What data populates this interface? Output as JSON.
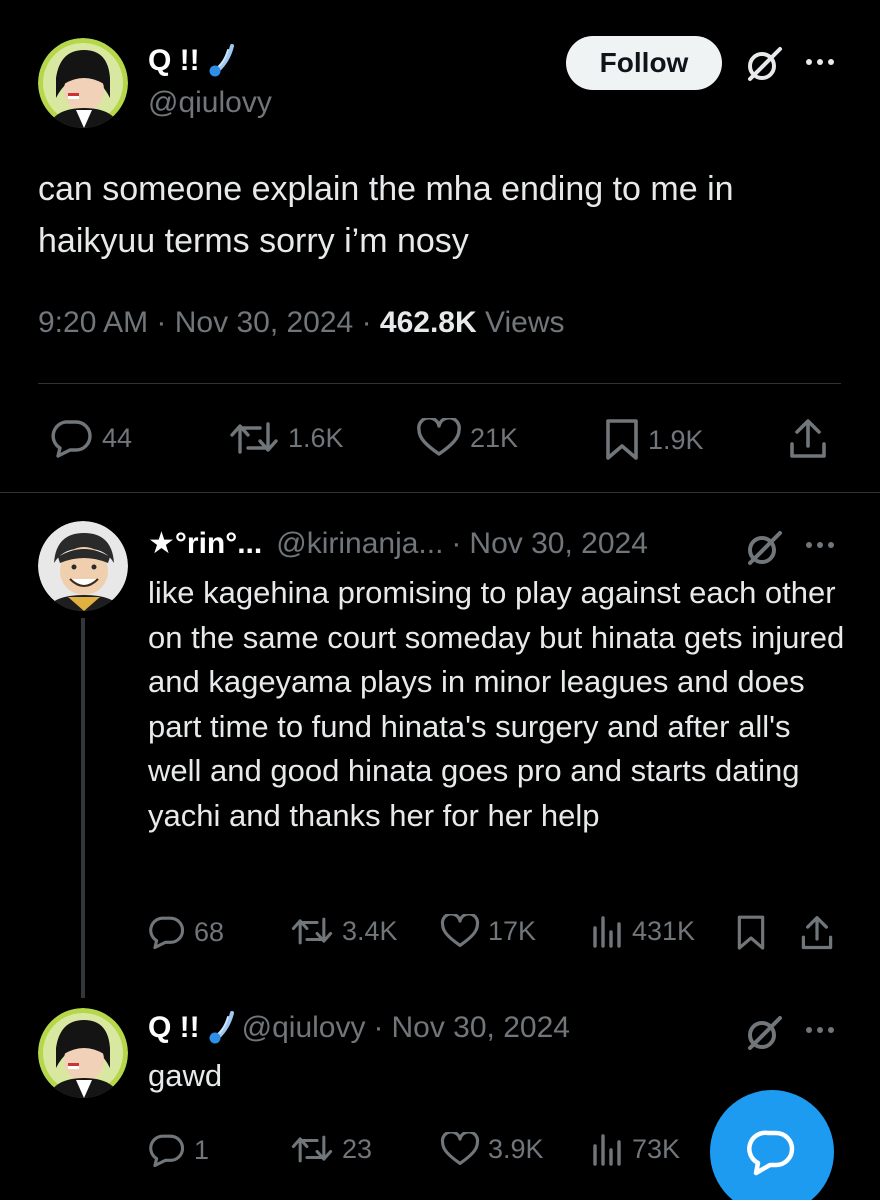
{
  "main_tweet": {
    "display_name": "Q !!",
    "handle": "@qiulovy",
    "follow_label": "Follow",
    "text": "can someone explain the mha ending to me in haikyuu terms sorry i’m nosy",
    "time": "9:20 AM",
    "date": "Nov 30, 2024",
    "views_count": "462.8K",
    "views_label": "Views",
    "actions": {
      "replies": "44",
      "reposts": "1.6K",
      "likes": "21K",
      "bookmarks": "1.9K"
    }
  },
  "reply_1": {
    "display_name": "★°rin°...",
    "handle": "@kirinanja...",
    "date": "Nov 30, 2024",
    "text": "like kagehina promising to play against each other on the same court someday but hinata gets injured and kageyama plays in minor leagues and does part time to fund hinata's surgery and after all's well and good hinata goes pro and starts dating yachi and thanks her for her help",
    "actions": {
      "replies": "68",
      "reposts": "3.4K",
      "likes": "17K",
      "views": "431K"
    }
  },
  "reply_2": {
    "display_name": "Q !!",
    "handle": "@qiulovy",
    "date": "Nov 30, 2024",
    "text": "gawd",
    "actions": {
      "replies": "1",
      "reposts": "23",
      "likes": "3.9K",
      "views": "73K"
    }
  },
  "separator": "·",
  "icons": [
    "comet-icon",
    "grok-icon",
    "more-icon",
    "reply-icon",
    "repost-icon",
    "like-icon",
    "bookmark-icon",
    "share-icon",
    "views-icon",
    "compose-reply-icon"
  ],
  "colors": {
    "background": "#000000",
    "text": "#e7e9ea",
    "muted": "#71767b",
    "divider": "#2f3336",
    "accent": "#1d9bf0",
    "follow_bg": "#eff3f4"
  }
}
